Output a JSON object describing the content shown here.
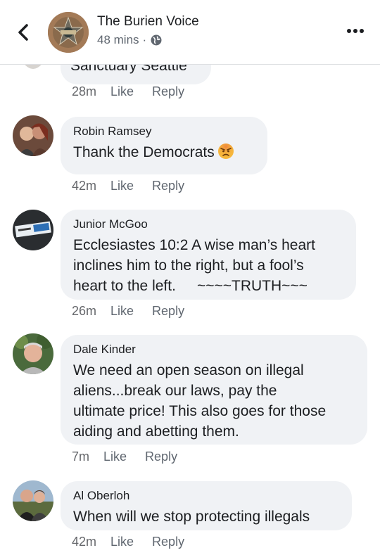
{
  "header": {
    "page_name": "The Burien Voice",
    "time": "48 mins",
    "dot": "·",
    "icons": {
      "back": "chevron-left-icon",
      "privacy": "globe-icon",
      "more": "more-horizontal-icon"
    }
  },
  "clipped_comment": {
    "text": "Sanctuary Seattle",
    "time": "28m",
    "like_label": "Like",
    "reply_label": "Reply"
  },
  "comments": [
    {
      "name": "Robin Ramsey",
      "lines": [
        "Thank the Democrats"
      ],
      "emoji": "angry-face-icon",
      "time": "42m",
      "like_label": "Like",
      "reply_label": "Reply"
    },
    {
      "name": "Junior McGoo",
      "lines": [
        "Ecclesiastes 10:2  A wise man’s heart",
        "inclines him to the right, but a fool’s",
        "heart to the left."
      ],
      "tail": "~~~~TRUTH~~~",
      "time": "26m",
      "like_label": "Like",
      "reply_label": "Reply"
    },
    {
      "name": "Dale Kinder",
      "lines": [
        "We need an open season on illegal",
        "aliens...break our laws, pay the",
        "ultimate price! This also goes for those",
        "aiding and abetting them."
      ],
      "time": "7m",
      "like_label": "Like",
      "reply_label": "Reply"
    },
    {
      "name": "Al Oberloh",
      "lines": [
        "When will we stop protecting illegals"
      ],
      "time": "42m",
      "like_label": "Like",
      "reply_label": "Reply"
    }
  ],
  "colors": {
    "bubble": "#f0f2f5",
    "secondary_text": "#606770",
    "primary_text": "#1c1e21",
    "divider": "#dddfe2"
  }
}
